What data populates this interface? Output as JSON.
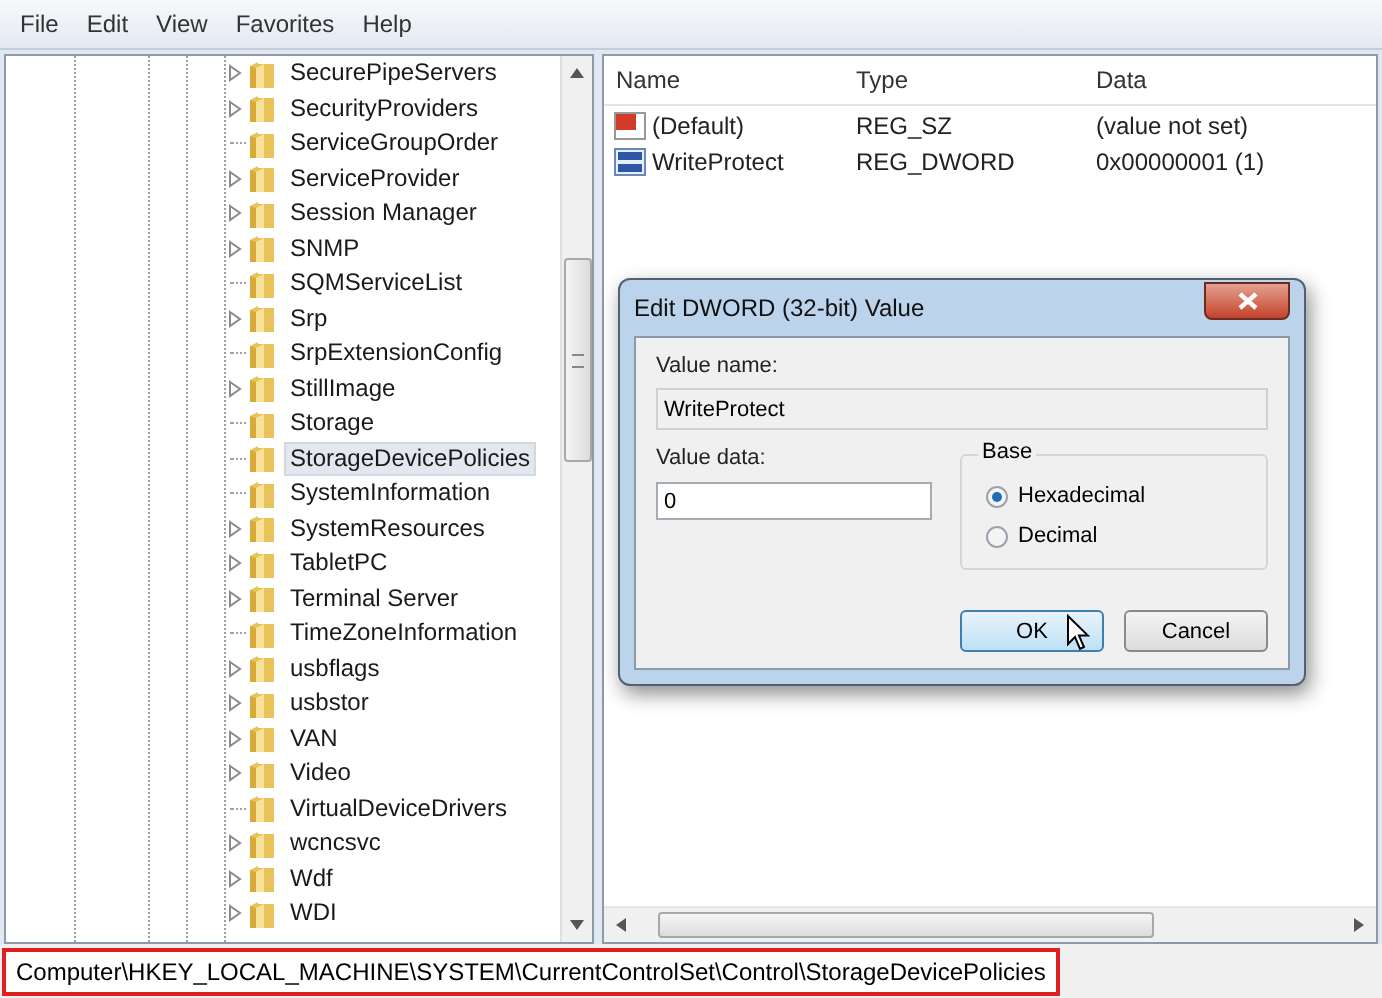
{
  "menu": [
    "File",
    "Edit",
    "View",
    "Favorites",
    "Help"
  ],
  "tree": {
    "items": [
      {
        "label": "SecurePipeServers",
        "expandable": true,
        "selected": false
      },
      {
        "label": "SecurityProviders",
        "expandable": true,
        "selected": false
      },
      {
        "label": "ServiceGroupOrder",
        "expandable": false,
        "selected": false
      },
      {
        "label": "ServiceProvider",
        "expandable": true,
        "selected": false
      },
      {
        "label": "Session Manager",
        "expandable": true,
        "selected": false
      },
      {
        "label": "SNMP",
        "expandable": true,
        "selected": false
      },
      {
        "label": "SQMServiceList",
        "expandable": false,
        "selected": false
      },
      {
        "label": "Srp",
        "expandable": true,
        "selected": false
      },
      {
        "label": "SrpExtensionConfig",
        "expandable": false,
        "selected": false
      },
      {
        "label": "StillImage",
        "expandable": true,
        "selected": false
      },
      {
        "label": "Storage",
        "expandable": false,
        "selected": false
      },
      {
        "label": "StorageDevicePolicies",
        "expandable": false,
        "selected": true
      },
      {
        "label": "SystemInformation",
        "expandable": false,
        "selected": false
      },
      {
        "label": "SystemResources",
        "expandable": true,
        "selected": false
      },
      {
        "label": "TabletPC",
        "expandable": true,
        "selected": false
      },
      {
        "label": "Terminal Server",
        "expandable": true,
        "selected": false
      },
      {
        "label": "TimeZoneInformation",
        "expandable": false,
        "selected": false
      },
      {
        "label": "usbflags",
        "expandable": true,
        "selected": false
      },
      {
        "label": "usbstor",
        "expandable": true,
        "selected": false
      },
      {
        "label": "VAN",
        "expandable": true,
        "selected": false
      },
      {
        "label": "Video",
        "expandable": true,
        "selected": false
      },
      {
        "label": "VirtualDeviceDrivers",
        "expandable": false,
        "selected": false
      },
      {
        "label": "wcncsvc",
        "expandable": true,
        "selected": false
      },
      {
        "label": "Wdf",
        "expandable": true,
        "selected": false
      },
      {
        "label": "WDI",
        "expandable": true,
        "selected": false
      }
    ]
  },
  "values": {
    "columns": [
      "Name",
      "Type",
      "Data"
    ],
    "rows": [
      {
        "kind": "string",
        "name": "(Default)",
        "type": "REG_SZ",
        "data": "(value not set)"
      },
      {
        "kind": "binary",
        "name": "WriteProtect",
        "type": "REG_DWORD",
        "data": "0x00000001 (1)"
      }
    ]
  },
  "dialog": {
    "title": "Edit DWORD (32-bit) Value",
    "value_name_label": "Value name:",
    "value_name": "WriteProtect",
    "value_data_label": "Value data:",
    "value_data": "0",
    "base_label": "Base",
    "base_options": [
      {
        "label": "Hexadecimal",
        "selected": true
      },
      {
        "label": "Decimal",
        "selected": false
      }
    ],
    "buttons": [
      {
        "label": "OK",
        "default": true
      },
      {
        "label": "Cancel",
        "default": false
      }
    ]
  },
  "status_bar": {
    "path": "Computer\\HKEY_LOCAL_MACHINE\\SYSTEM\\CurrentControlSet\\Control\\StorageDevicePolicies"
  }
}
